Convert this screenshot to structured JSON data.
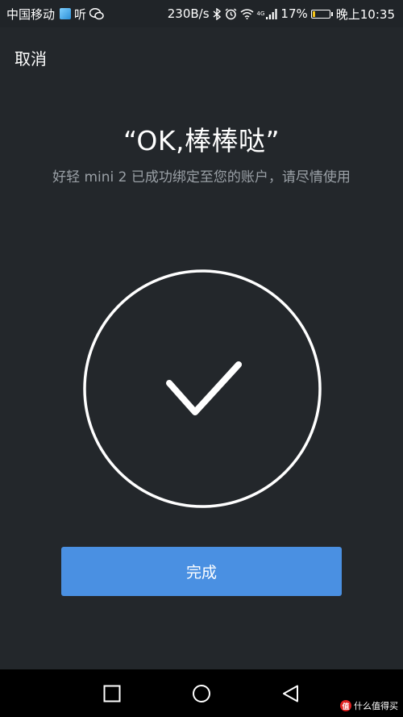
{
  "status_bar": {
    "carrier": "中国移动",
    "app_text": "听",
    "speed": "230B/s",
    "network_tag": "4G",
    "battery_percent": "17%",
    "battery_level": 0.17,
    "time": "晚上10:35"
  },
  "header": {
    "cancel_label": "取消"
  },
  "main": {
    "title": "“OK,棒棒哒”",
    "subtitle": "好轻 mini 2 已成功绑定至您的账户，请尽情使用",
    "success_icon": "checkmark-circle-icon"
  },
  "actions": {
    "done_label": "完成"
  },
  "nav": {
    "icons": [
      "recent-apps-icon",
      "home-icon",
      "back-icon"
    ]
  },
  "watermark": {
    "logo_text": "值",
    "text": "什么值得买"
  },
  "colors": {
    "background": "#23272b",
    "button": "#4a90e2",
    "subtitle": "#9aa0a6",
    "battery": "#f5c518"
  }
}
